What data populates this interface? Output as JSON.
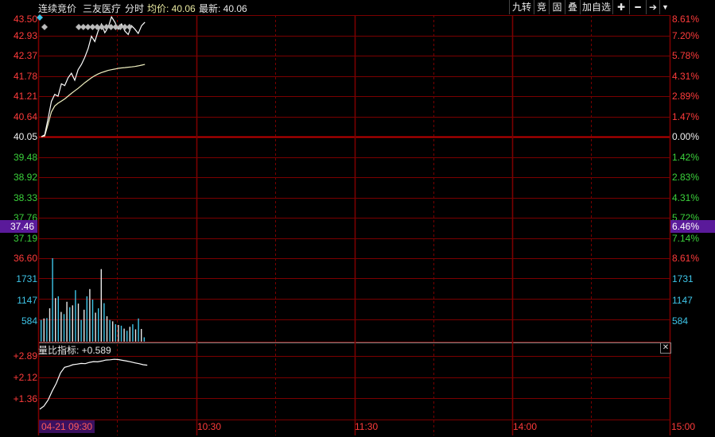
{
  "header": {
    "mode": "连续竞价",
    "stock_name": "三友医疗",
    "period": "分时",
    "avg_label": "均价: 40.06",
    "latest_label": "最新: 40.06"
  },
  "toolbar": {
    "buttons": [
      "九转",
      "竞",
      "固",
      "叠",
      "加自选"
    ],
    "icons": [
      "plus-icon",
      "minus-icon",
      "arrow-right-bar-icon",
      "dropdown-triangle-icon"
    ],
    "icon_glyphs": [
      "✚",
      "━",
      "➔",
      "▼"
    ]
  },
  "price_axis": {
    "left": [
      "43.50",
      "42.93",
      "42.37",
      "41.78",
      "41.21",
      "40.64",
      "40.05",
      "39.48",
      "38.92",
      "38.33",
      "37.76",
      "37.19",
      "36.60"
    ],
    "right": [
      "8.61%",
      "7.20%",
      "5.78%",
      "4.31%",
      "2.89%",
      "1.47%",
      "0.00%",
      "1.42%",
      "2.83%",
      "4.31%",
      "5.72%",
      "7.14%",
      "8.61%"
    ],
    "cursor_price": "37.46",
    "cursor_pct": "6.46%"
  },
  "volume_axis": {
    "left": [
      "1731",
      "1147",
      "584"
    ],
    "right": [
      "1731",
      "1147",
      "584"
    ]
  },
  "indicator": {
    "title": "量比指标: +0.589",
    "axis": [
      "+2.89",
      "+2.12",
      "+1.36"
    ]
  },
  "time_axis": {
    "start": "04-21 09:30",
    "labels": [
      "10:30",
      "11:30",
      "14:00",
      "15:00"
    ]
  },
  "colors": {
    "grid_red": "#7a0000",
    "price_line": "#ffffff",
    "avg_line": "#f0f0c0",
    "volume_bar": "#e8e8e8",
    "volume_bar_cyan": "#3ec5e8"
  },
  "chart_data": {
    "type": "line",
    "series": [
      {
        "values": [
          40.05,
          40.1,
          40.55,
          41.05,
          41.25,
          41.2,
          41.55,
          41.5,
          41.72,
          41.85,
          41.65,
          41.95,
          42.1,
          42.3,
          42.55,
          42.9,
          42.75,
          43.05,
          43.25,
          43.0,
          43.15,
          43.45,
          43.3,
          43.1,
          43.25,
          43.05,
          42.95,
          43.2,
          43.1,
          42.98,
          43.2,
          43.3
        ]
      },
      {
        "values": [
          40.05,
          40.07,
          40.4,
          40.75,
          40.92,
          41.0,
          41.06,
          41.12,
          41.2,
          41.28,
          41.35,
          41.42,
          41.5,
          41.58,
          41.65,
          41.72,
          41.78,
          41.83,
          41.87,
          41.9,
          41.93,
          41.95,
          41.97,
          41.99,
          42.0,
          42.01,
          42.02,
          42.03,
          42.04,
          42.06,
          42.08,
          42.1
        ]
      }
    ],
    "ylim": [
      36.6,
      43.5
    ],
    "volume_values": [
      600,
      640,
      650,
      920,
      2300,
      1200,
      1250,
      820,
      760,
      1100,
      950,
      1000,
      1420,
      1050,
      600,
      880,
      1250,
      1450,
      1160,
      800,
      920,
      2000,
      1060,
      700,
      600,
      560,
      480,
      460,
      440,
      360,
      300,
      410,
      480,
      340,
      640,
      350,
      120
    ],
    "volume_ylim": [
      0,
      2300
    ],
    "indicator_values": [
      1.0,
      1.12,
      1.35,
      1.7,
      2.0,
      2.4,
      2.62,
      2.66,
      2.72,
      2.74,
      2.77,
      2.76,
      2.81,
      2.84,
      2.83,
      2.86,
      2.9,
      2.91,
      2.93,
      2.92,
      2.89,
      2.86,
      2.83,
      2.79,
      2.76,
      2.72,
      2.7
    ],
    "indicator_ylim": [
      0.6,
      3.15
    ]
  }
}
